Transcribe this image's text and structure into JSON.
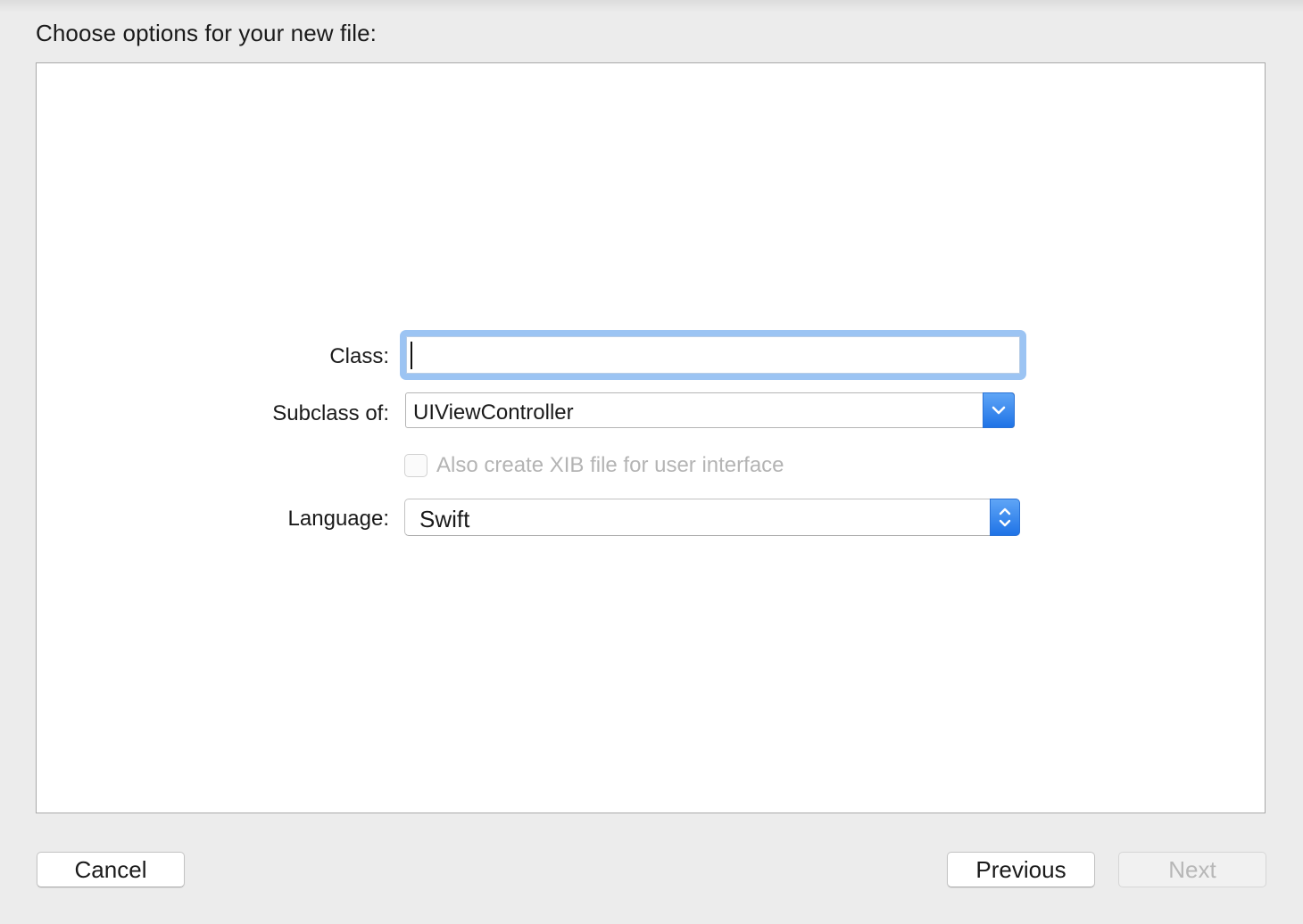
{
  "header": {
    "title": "Choose options for your new file:"
  },
  "form": {
    "class_label": "Class:",
    "class_value": "",
    "subclass_label": "Subclass of:",
    "subclass_value": "UIViewController",
    "xib_checkbox_label": "Also create XIB file for user interface",
    "xib_checked": false,
    "xib_enabled": false,
    "language_label": "Language:",
    "language_value": "Swift"
  },
  "footer": {
    "cancel_label": "Cancel",
    "previous_label": "Previous",
    "next_label": "Next"
  },
  "icons": {
    "combo_arrow": "chevron-down-icon",
    "popup_arrows": "up-down-chevron-icon"
  },
  "colors": {
    "accent": "#1f73e6",
    "focus_ring": "#9cc4f3",
    "disabled_text": "#b4b4b4"
  }
}
